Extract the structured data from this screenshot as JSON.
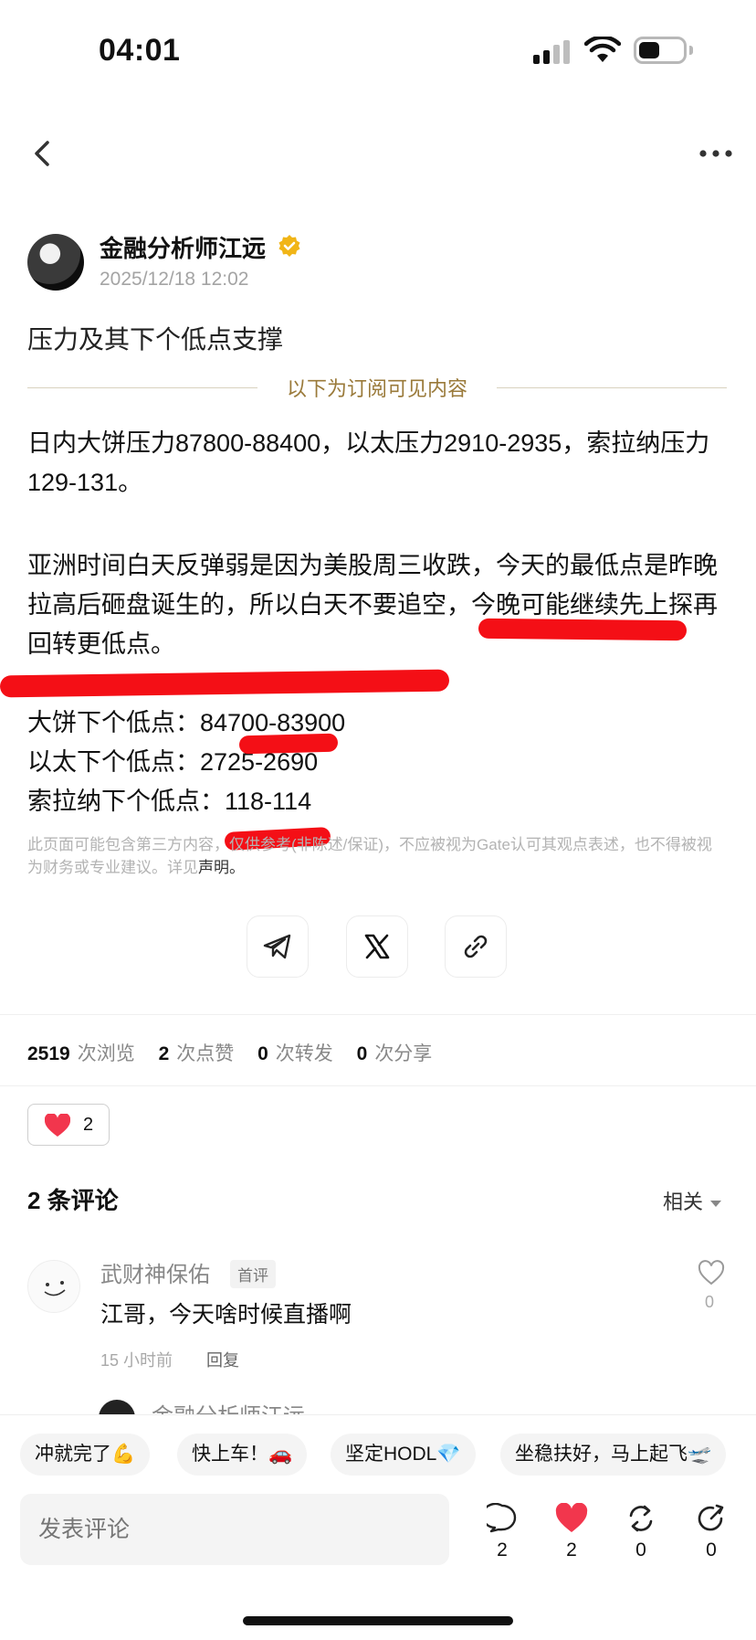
{
  "status_bar": {
    "time": "04:01"
  },
  "author": {
    "name": "金融分析师江远",
    "date": "2025/12/18 12:02"
  },
  "post": {
    "title": "压力及其下个低点支撑",
    "subscription_divider": "以下为订阅可见内容",
    "paragraph1": "日内大饼压力87800-88400，以太压力2910-2935，索拉纳压力129-131。",
    "paragraph2": "亚洲时间白天反弹弱是因为美股周三收跌，今天的最低点是昨晚拉高后砸盘诞生的，所以白天不要追空，今晚可能继续先上探再回转更低点。",
    "lows": [
      "大饼下个低点：84700-83900",
      "以太下个低点：2725-2690",
      "索拉纳下个低点：118-114"
    ],
    "disclaimer": "此页面可能包含第三方内容，仅供参考(非陈述/保证)，不应被视为Gate认可其观点表述，也不得被视为财务或专业建议。详见",
    "disclaimer_link": "声明。"
  },
  "share": {
    "icons": [
      "telegram-icon",
      "x-icon",
      "link-icon"
    ]
  },
  "stats": {
    "views": "2519",
    "views_label": "次浏览",
    "likes": "2",
    "likes_label": "次点赞",
    "reposts": "0",
    "reposts_label": "次转发",
    "shares": "0",
    "shares_label": "次分享"
  },
  "reaction": {
    "count": "2"
  },
  "comments": {
    "title": "2 条评论",
    "sort": "相关",
    "items": [
      {
        "name": "武财神保佑",
        "badge": "首评",
        "text": "江哥，今天啥时候直播啊",
        "time": "15 小时前",
        "reply": "回复",
        "likes": "0"
      }
    ],
    "peek_name": "金融分析师江远"
  },
  "quick_replies": [
    "冲就完了💪",
    "快上车！🚗",
    "坚定HODL💎",
    "坐稳扶好，马上起飞🛫"
  ],
  "composer": {
    "placeholder": "发表评论"
  },
  "actions": {
    "comments": "2",
    "likes": "2",
    "reposts": "0",
    "shares": "0"
  },
  "colors": {
    "accent_gold": "#9a7a3a",
    "annotation_red": "#f40f16",
    "heart_red": "#f2364d"
  }
}
